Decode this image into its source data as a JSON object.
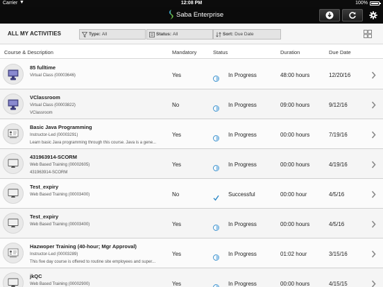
{
  "statusbar": {
    "carrier": "Carrier",
    "time": "12:08 PM",
    "battery": "100%"
  },
  "navbar": {
    "brand": "Saba Enterprise",
    "buttons": [
      "download-icon",
      "refresh-icon",
      "gear-icon"
    ]
  },
  "filterbar": {
    "title": "ALL MY ACTIVITIES",
    "type": {
      "label": "Type:",
      "value": "All"
    },
    "status": {
      "label": "Status:",
      "value": "All"
    },
    "sort": {
      "label": "Sort:",
      "value": "Due Date"
    }
  },
  "table": {
    "headers": {
      "course": "Course & Description",
      "mandatory": "Mandatory",
      "status": "Status",
      "duration": "Duration",
      "due": "Due Date"
    },
    "rows": [
      {
        "icon": "virtual-class-icon",
        "title": "85 fulltime",
        "sub": "Virtual Class (00003646)",
        "desc": "",
        "mandatory": "Yes",
        "status": "In Progress",
        "status_icon": "progress",
        "duration": "48:00 hours",
        "due": "12/20/16"
      },
      {
        "icon": "virtual-class-icon",
        "title": "VClassroom",
        "sub": "Virtual Class (00003822)",
        "desc": "VClassroom",
        "mandatory": "No",
        "status": "In Progress",
        "status_icon": "progress",
        "duration": "09:00 hours",
        "due": "9/12/16"
      },
      {
        "icon": "instructor-led-icon",
        "title": "Basic Java Programming",
        "sub": "Instructor-Led (00003291)",
        "desc": "Learn basic Java programming through this course. Java is a gene...",
        "mandatory": "Yes",
        "status": "In Progress",
        "status_icon": "progress",
        "duration": "00:00 hours",
        "due": "7/19/16"
      },
      {
        "icon": "web-training-icon",
        "title": "431963914-SCORM",
        "sub": "Web Based Training (00002605)",
        "desc": "431963914-SCORM",
        "mandatory": "Yes",
        "status": "In Progress",
        "status_icon": "progress",
        "duration": "00:00 hours",
        "due": "4/19/16"
      },
      {
        "icon": "web-training-icon",
        "title": "Test_expiry",
        "sub": "Web Based Training (00003400)",
        "desc": "",
        "mandatory": "No",
        "status": "Successful",
        "status_icon": "success",
        "duration": "00:00 hour",
        "due": "4/5/16"
      },
      {
        "icon": "web-training-icon",
        "title": "Test_expiry",
        "sub": "Web Based Training (00003400)",
        "desc": "",
        "mandatory": "Yes",
        "status": "In Progress",
        "status_icon": "progress",
        "duration": "00:00 hours",
        "due": "4/5/16"
      },
      {
        "icon": "instructor-led-icon",
        "title": "Hazwoper Training (40-hour; Mgr Approval)",
        "sub": "Instructor-Led (00003289)",
        "desc": "This five day course is offered to routine site employees and super...",
        "mandatory": "Yes",
        "status": "In Progress",
        "status_icon": "progress",
        "duration": "01:02 hour",
        "due": "3/15/16"
      },
      {
        "icon": "web-training-icon",
        "title": "jkQC",
        "sub": "Web Based Training (00002900)",
        "desc": "",
        "mandatory": "Yes",
        "status": "In Progress",
        "status_icon": "progress",
        "duration": "00:00 hours",
        "due": "4/15/15"
      }
    ]
  },
  "colors": {
    "accent": "#2d89c8",
    "nav_bg": "#0b0b0b"
  }
}
